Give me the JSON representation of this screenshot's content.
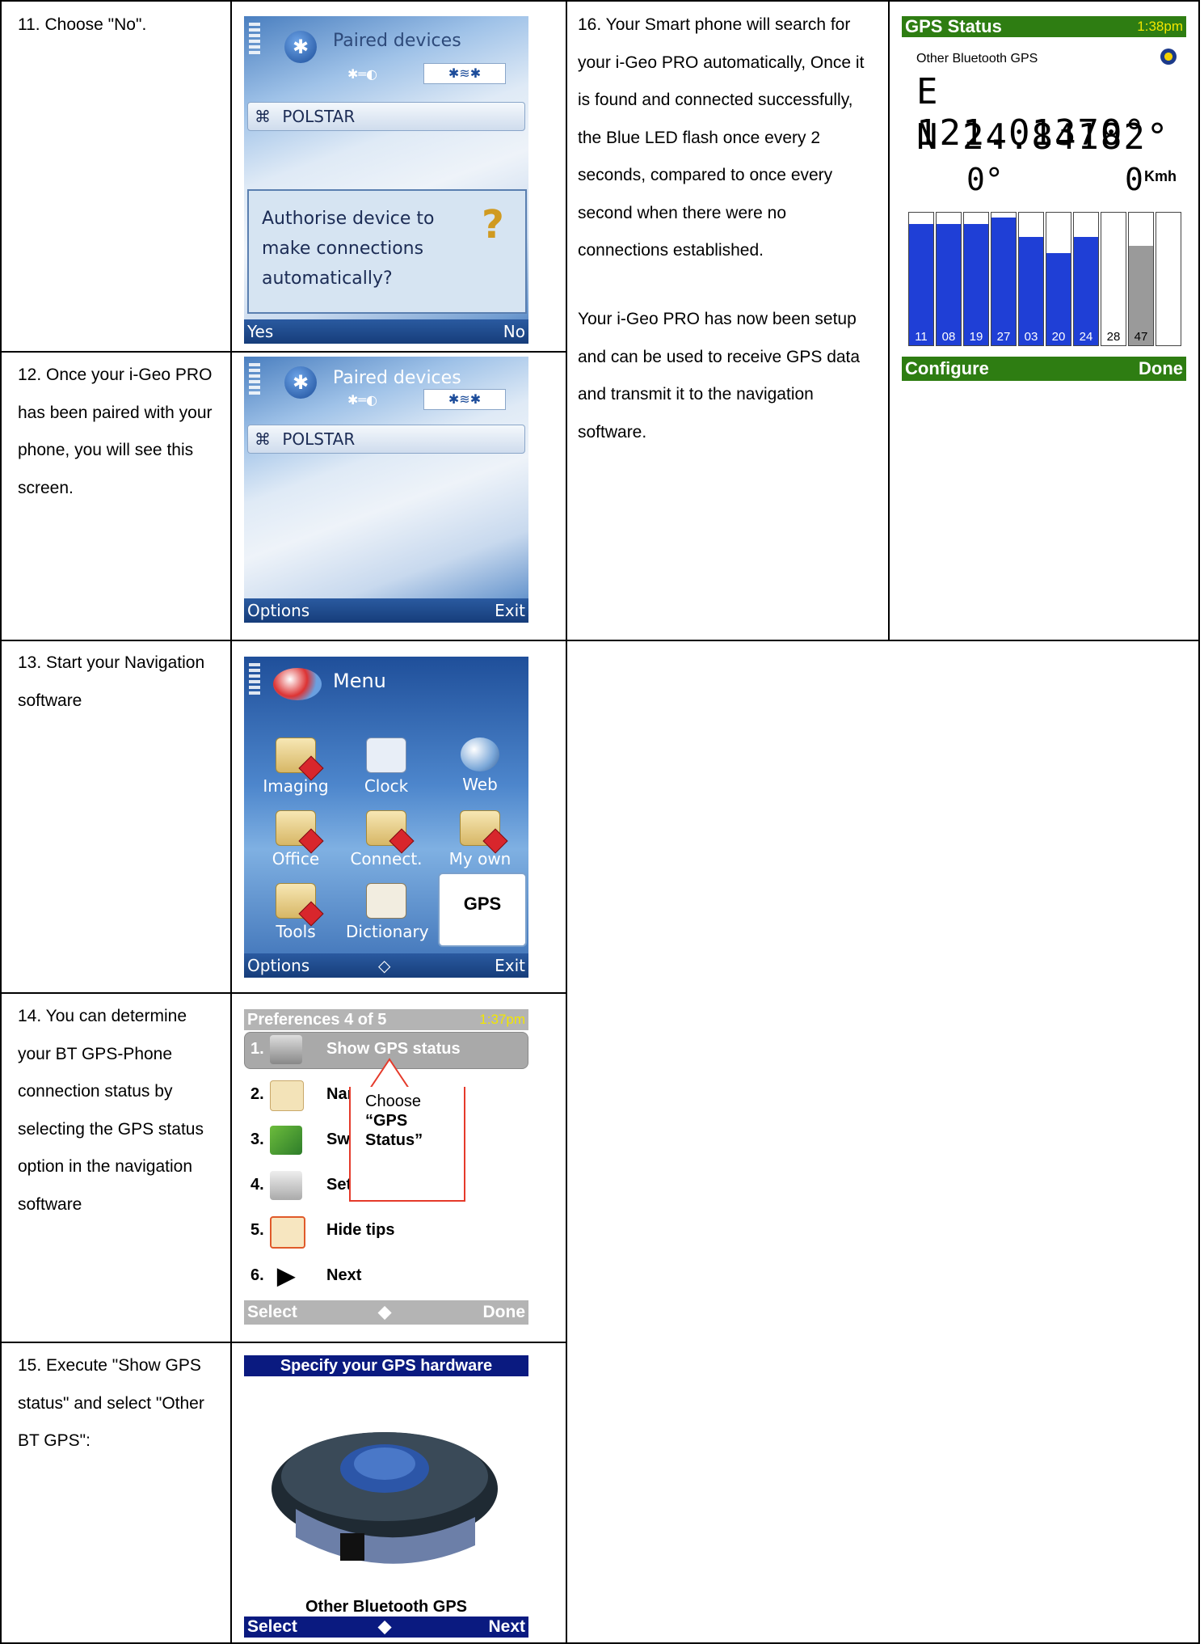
{
  "steps": {
    "s11": "11. Choose \"No\".",
    "s12": "12. Once your i-Geo PRO has been paired with your phone, you will see this screen.",
    "s13": "13. Start your Navigation software",
    "s14": "14. You can determine your BT GPS-Phone connection status by selecting the GPS status option in the navigation software",
    "s15": "15. Execute \"Show GPS status\" and select \"Other BT GPS\":",
    "s16a": "16. Your Smart phone will search for your i-Geo PRO automatically, Once it is found and connected successfully, the Blue LED flash once every 2 seconds, compared to once every second when there were no connections established.",
    "s16b": "Your i-Geo PRO has now been setup and can be used to receive GPS data and transmit it to the navigation software."
  },
  "screen11": {
    "title": "Paired devices",
    "device": "POLSTAR",
    "dialog": "Authorise device to make connections automatically?",
    "soft_left": "Yes",
    "soft_right": "No"
  },
  "screen12": {
    "title": "Paired devices",
    "device": "POLSTAR",
    "soft_left": "Options",
    "soft_right": "Exit"
  },
  "screen13": {
    "title": "Menu",
    "items": [
      "Imaging",
      "Clock",
      "Web",
      "Office",
      "Connect.",
      "My own",
      "Tools",
      "Dictionary"
    ],
    "gps_label": "GPS",
    "soft_left": "Options",
    "soft_right": "Exit"
  },
  "screen14": {
    "title": "Preferences 4 of 5",
    "time": "1:37pm",
    "rows": [
      {
        "num": "1.",
        "label": "Show GPS status"
      },
      {
        "num": "2.",
        "label": "Nar"
      },
      {
        "num": "3.",
        "label": "Sw"
      },
      {
        "num": "4.",
        "label": "Set"
      },
      {
        "num": "5.",
        "label": "Hide tips"
      },
      {
        "num": "6.",
        "label": "Next"
      }
    ],
    "callout_line1": "Choose",
    "callout_line2": "“GPS",
    "callout_line3": "Status”",
    "soft_left": "Select",
    "soft_right": "Done"
  },
  "screen15": {
    "title": "Specify your GPS hardware",
    "caption": "Other Bluetooth GPS",
    "soft_left": "Select",
    "soft_right": "Next"
  },
  "screen16": {
    "title": "GPS Status",
    "time": "1:38pm",
    "source": "Other Bluetooth GPS",
    "lon": "E 121.01370°",
    "lat": "N 24.84182°",
    "heading": "0°",
    "speed": "0",
    "speed_unit": "Kmh",
    "soft_left": "Configure",
    "soft_right": "Done",
    "bar_color": "#1f3fd6",
    "bars": [
      {
        "sv": "11",
        "level": 0.95,
        "color": "blue"
      },
      {
        "sv": "08",
        "level": 0.95,
        "color": "blue"
      },
      {
        "sv": "19",
        "level": 0.95,
        "color": "blue"
      },
      {
        "sv": "27",
        "level": 1.0,
        "color": "blue"
      },
      {
        "sv": "03",
        "level": 0.85,
        "color": "blue"
      },
      {
        "sv": "20",
        "level": 0.72,
        "color": "blue"
      },
      {
        "sv": "24",
        "level": 0.85,
        "color": "blue"
      },
      {
        "sv": "28",
        "level": 0.0,
        "color": "none"
      },
      {
        "sv": "47",
        "level": 0.78,
        "color": "gray"
      },
      {
        "sv": "",
        "level": 0.0,
        "color": "none"
      }
    ]
  }
}
